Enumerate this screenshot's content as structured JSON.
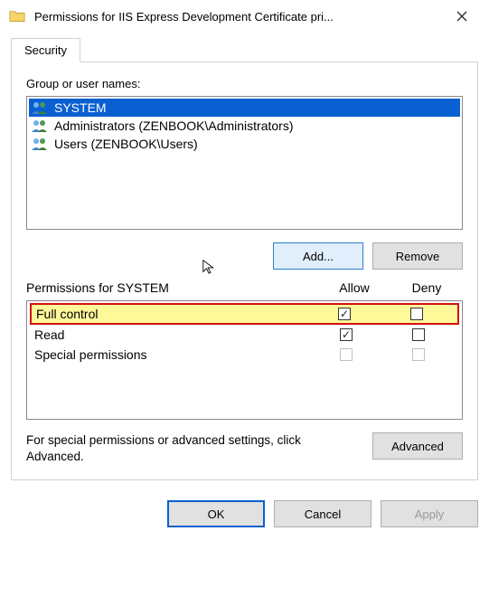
{
  "window": {
    "title": "Permissions for IIS Express Development Certificate pri..."
  },
  "tabs": {
    "security_label": "Security"
  },
  "group": {
    "label": "Group or user names:",
    "users": [
      {
        "name": "SYSTEM",
        "selected": true
      },
      {
        "name": "Administrators (ZENBOOK\\Administrators)",
        "selected": false
      },
      {
        "name": "Users (ZENBOOK\\Users)",
        "selected": false
      }
    ]
  },
  "buttons": {
    "add": "Add...",
    "remove": "Remove",
    "advanced": "Advanced",
    "ok": "OK",
    "cancel": "Cancel",
    "apply": "Apply"
  },
  "perms": {
    "header_for": "Permissions for SYSTEM",
    "allow": "Allow",
    "deny": "Deny",
    "rows": [
      {
        "label": "Full control",
        "allow": true,
        "deny": false,
        "highlight": true,
        "disabled": false
      },
      {
        "label": "Read",
        "allow": true,
        "deny": false,
        "highlight": false,
        "disabled": false
      },
      {
        "label": "Special permissions",
        "allow": false,
        "deny": false,
        "highlight": false,
        "disabled": true
      }
    ]
  },
  "advanced_hint": "For special permissions or advanced settings, click Advanced."
}
